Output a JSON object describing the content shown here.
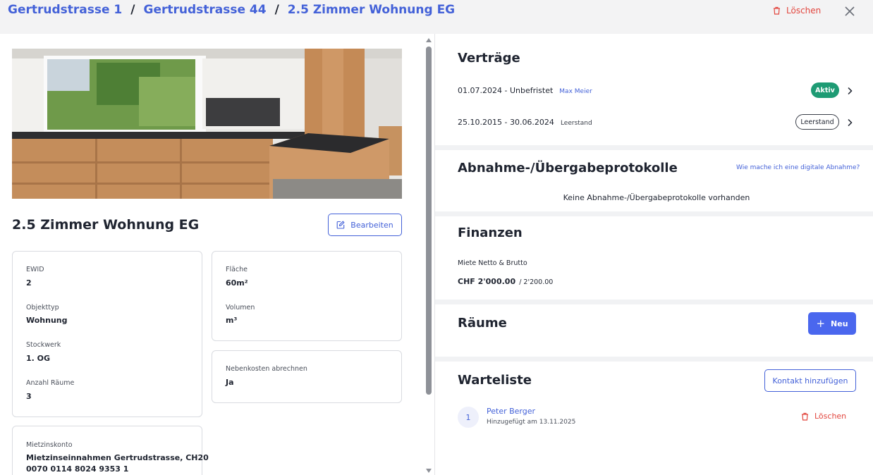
{
  "breadcrumb": {
    "items": [
      "Gertrudstrasse 1",
      "Gertrudstrasse 44",
      "2.5 Zimmer Wohnung EG"
    ],
    "separator": "/"
  },
  "header": {
    "delete_label": "Löschen",
    "close_icon": "close-icon"
  },
  "unit": {
    "title": "2.5 Zimmer Wohnung EG",
    "edit_label": "Bearbeiten",
    "fields_left": [
      {
        "label": "EWID",
        "value": "2"
      },
      {
        "label": "Objekttyp",
        "value": "Wohnung"
      },
      {
        "label": "Stockwerk",
        "value": "1. OG"
      },
      {
        "label": "Anzahl Räume",
        "value": "3"
      }
    ],
    "area": {
      "label": "Fläche",
      "value": "60m²"
    },
    "volume": {
      "label": "Volumen",
      "value": "m³"
    },
    "ancillary": {
      "label": "Nebenkosten abrechnen",
      "value": "Ja"
    },
    "rent_account": {
      "label": "Mietzinskonto",
      "value_line1": "Mietzinseinnahmen Gertrudstrasse, CH20",
      "value_line2": "0070 0114 8024 9353 1"
    }
  },
  "contracts": {
    "title": "Verträge",
    "items": [
      {
        "period": "01.07.2024 - Unbefristet",
        "tenant": "Max Meier",
        "status": "Aktiv"
      },
      {
        "period": "25.10.2015 - 30.06.2024",
        "tenant": "Leerstand",
        "status": "Leerstand"
      }
    ]
  },
  "protocols": {
    "title": "Abnahme-/Übergabeprotokolle",
    "help_link": "Wie mache ich eine digitale Abnahme?",
    "empty": "Keine Abnahme-/Übergabeprotokolle vorhanden"
  },
  "finances": {
    "title": "Finanzen",
    "rent_label": "Miete Netto & Brutto",
    "rent_net": "CHF 2'000.00",
    "rent_gross": "/ 2'200.00"
  },
  "rooms": {
    "title": "Räume",
    "new_label": "Neu"
  },
  "waitlist": {
    "title": "Warteliste",
    "add_label": "Kontakt hinzufügen",
    "entries": [
      {
        "number": "1",
        "name": "Peter Berger",
        "added": "Hinzugefügt am 13.11.2025",
        "delete_label": "Löschen"
      }
    ]
  },
  "colors": {
    "accent": "#4361d8",
    "primary_button": "#4a67ee",
    "danger": "#e2463e",
    "success": "#1e9b74"
  }
}
